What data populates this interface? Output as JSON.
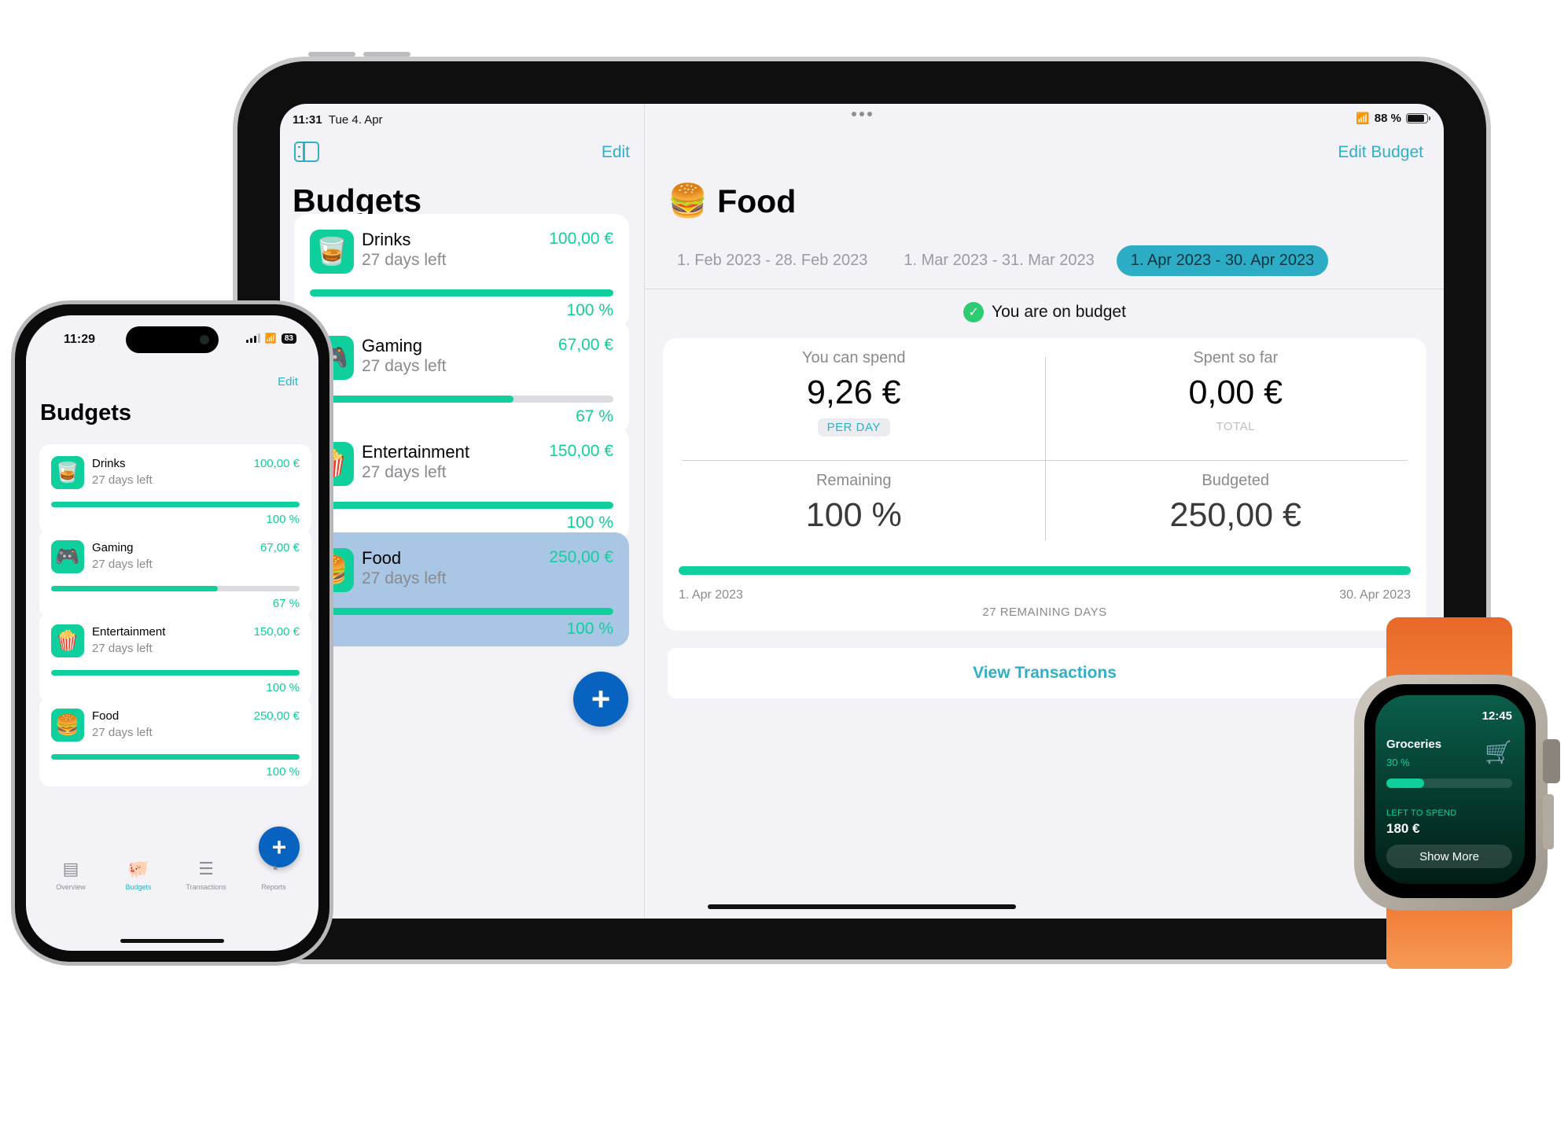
{
  "ipad": {
    "status": {
      "time": "11:31",
      "date": "Tue 4. Apr",
      "battery": "88 %",
      "battery_level": 0.88
    },
    "sidebar": {
      "edit_label": "Edit",
      "title": "Budgets",
      "budgets": [
        {
          "name": "Drinks",
          "icon": "🥃",
          "days_left": "27 days left",
          "amount": "100,00 €",
          "percent_label": "100 %",
          "progress": 1.0,
          "selected": false
        },
        {
          "name": "Gaming",
          "icon": "🎮",
          "days_left": "27 days left",
          "amount": "67,00 €",
          "percent_label": "67 %",
          "progress": 0.67,
          "selected": false
        },
        {
          "name": "Entertainment",
          "icon": "🍿",
          "days_left": "27 days left",
          "amount": "150,00 €",
          "percent_label": "100 %",
          "progress": 1.0,
          "selected": false
        },
        {
          "name": "Food",
          "icon": "🍔",
          "days_left": "27 days left",
          "amount": "250,00 €",
          "percent_label": "100 %",
          "progress": 1.0,
          "selected": true
        }
      ],
      "add_label": "+"
    },
    "detail": {
      "edit_budget_label": "Edit Budget",
      "icon": "🍔",
      "title": "Food",
      "periods": [
        {
          "label": "1. Feb 2023 - 28. Feb 2023",
          "active": false
        },
        {
          "label": "1. Mar 2023 - 31. Mar 2023",
          "active": false
        },
        {
          "label": "1. Apr 2023 - 30. Apr 2023",
          "active": true
        }
      ],
      "status_text": "You are on budget",
      "can_spend": {
        "label": "You can spend",
        "value": "9,26 €",
        "chip": "PER DAY"
      },
      "spent": {
        "label": "Spent so far",
        "value": "0,00 €",
        "sub": "TOTAL"
      },
      "remaining": {
        "label": "Remaining",
        "value": "100 %"
      },
      "budgeted": {
        "label": "Budgeted",
        "value": "250,00 €"
      },
      "period_progress": 1.0,
      "start_date": "1. Apr 2023",
      "end_date": "30. Apr 2023",
      "remaining_days": "27 REMAINING DAYS",
      "view_transactions_label": "View Transactions"
    }
  },
  "iphone": {
    "status": {
      "time": "11:29",
      "battery": "83"
    },
    "edit_label": "Edit",
    "title": "Budgets",
    "budgets": [
      {
        "name": "Drinks",
        "icon": "🥃",
        "days_left": "27 days left",
        "amount": "100,00 €",
        "percent_label": "100 %",
        "progress": 1.0
      },
      {
        "name": "Gaming",
        "icon": "🎮",
        "days_left": "27 days left",
        "amount": "67,00 €",
        "percent_label": "67 %",
        "progress": 0.67
      },
      {
        "name": "Entertainment",
        "icon": "🍿",
        "days_left": "27 days left",
        "amount": "150,00 €",
        "percent_label": "100 %",
        "progress": 1.0
      },
      {
        "name": "Food",
        "icon": "🍔",
        "days_left": "27 days left",
        "amount": "250,00 €",
        "percent_label": "100 %",
        "progress": 1.0
      }
    ],
    "add_label": "+",
    "tabs": [
      {
        "label": "Overview",
        "icon": "overview-icon",
        "active": false
      },
      {
        "label": "Budgets",
        "icon": "piggy-bank-icon",
        "active": true
      },
      {
        "label": "Transactions",
        "icon": "list-icon",
        "active": false
      },
      {
        "label": "Reports",
        "icon": "pie-chart-icon",
        "active": false
      }
    ]
  },
  "watch": {
    "time": "12:45",
    "budget_name": "Groceries",
    "percent_label": "30 %",
    "progress": 0.3,
    "left_label": "LEFT TO SPEND",
    "left_value": "180 €",
    "button_label": "Show More"
  },
  "colors": {
    "accent_teal": "#2fb0c8",
    "progress_green": "#0fcf9c",
    "fab_blue": "#0862c0",
    "selected_row": "#a9c7e5",
    "background": "#f2f2f7"
  }
}
